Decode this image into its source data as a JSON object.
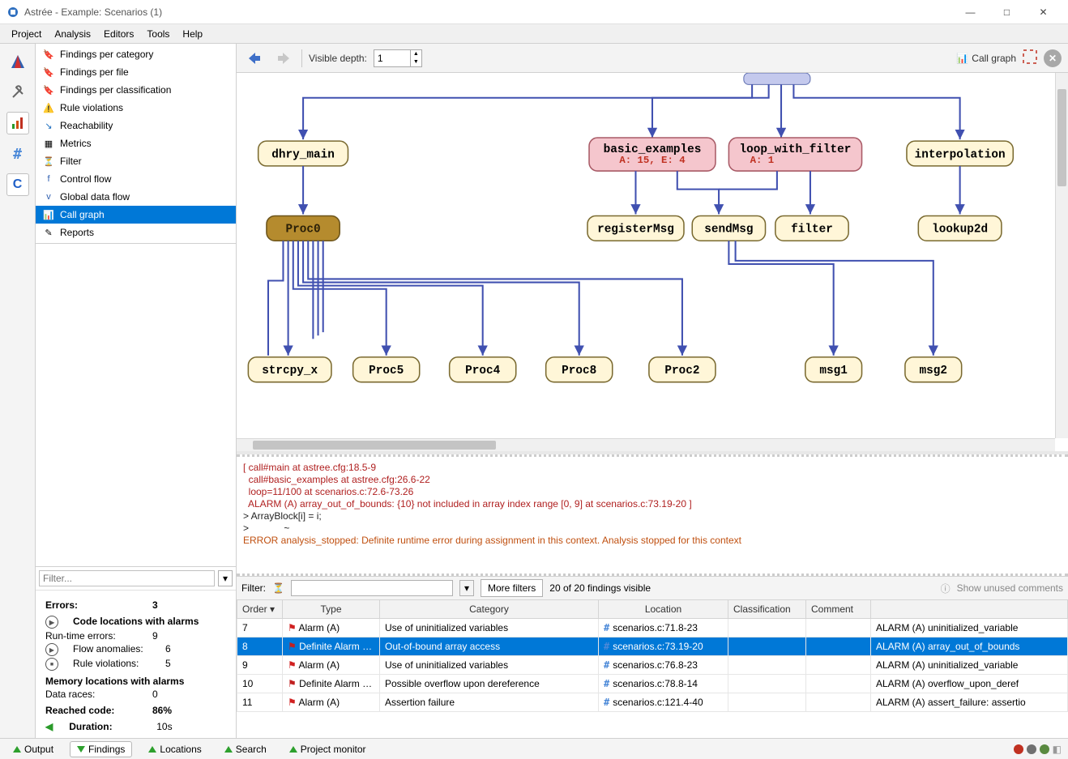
{
  "window": {
    "title": "Astrée - Example: Scenarios (1)"
  },
  "menu": {
    "items": [
      "Project",
      "Analysis",
      "Editors",
      "Tools",
      "Help"
    ]
  },
  "nav": {
    "items": [
      {
        "label": "Findings per category"
      },
      {
        "label": "Findings per file"
      },
      {
        "label": "Findings per classification"
      },
      {
        "label": "Rule violations"
      },
      {
        "label": "Reachability"
      },
      {
        "label": "Metrics"
      },
      {
        "label": "Filter"
      },
      {
        "label": "Control flow"
      },
      {
        "label": "Global data flow"
      },
      {
        "label": "Call graph",
        "selected": true
      },
      {
        "label": "Reports"
      }
    ]
  },
  "filterSidebar": {
    "placeholder": "Filter..."
  },
  "stats": {
    "errors_label": "Errors:",
    "errors": "3",
    "codeloc_header": "Code locations with alarms",
    "rte_label": "Run-time errors:",
    "rte": "9",
    "flow_label": "Flow anomalies:",
    "flow": "6",
    "rule_label": "Rule violations:",
    "rule": "5",
    "memloc_header": "Memory locations with alarms",
    "races_label": "Data races:",
    "races": "0",
    "reached_label": "Reached code:",
    "reached": "86%",
    "duration_label": "Duration:",
    "duration": "10s"
  },
  "graphToolbar": {
    "depthLabel": "Visible depth:",
    "depthValue": "1",
    "callGraphLabel": "Call graph"
  },
  "graph": {
    "nodes": {
      "dhry_main": {
        "label": "dhry_main",
        "fill": "#fff6d8",
        "stroke": "#7a6a30"
      },
      "basic_examples": {
        "label": "basic_examples",
        "sub": "A: 15,  E: 4",
        "fill": "#f5c6cd",
        "stroke": "#a85a66"
      },
      "loop_with_filter": {
        "label": "loop_with_filter",
        "sub": "A: 1",
        "fill": "#f5c6cd",
        "stroke": "#a85a66"
      },
      "interpolation": {
        "label": "interpolation",
        "fill": "#fff6d8",
        "stroke": "#7a6a30"
      },
      "proc0": {
        "label": "Proc0",
        "fill": "#b58b2e",
        "stroke": "#6c541b",
        "dark": true
      },
      "registerMsg": {
        "label": "registerMsg",
        "fill": "#fff6d8",
        "stroke": "#7a6a30"
      },
      "sendMsg": {
        "label": "sendMsg",
        "fill": "#fff6d8",
        "stroke": "#7a6a30"
      },
      "filter": {
        "label": "filter",
        "fill": "#fff6d8",
        "stroke": "#7a6a30"
      },
      "lookup2d": {
        "label": "lookup2d",
        "fill": "#fff6d8",
        "stroke": "#7a6a30"
      },
      "strcpy_x": {
        "label": "strcpy_x",
        "fill": "#fff6d8",
        "stroke": "#7a6a30"
      },
      "proc5": {
        "label": "Proc5",
        "fill": "#fff6d8",
        "stroke": "#7a6a30"
      },
      "proc4": {
        "label": "Proc4",
        "fill": "#fff6d8",
        "stroke": "#7a6a30"
      },
      "proc8": {
        "label": "Proc8",
        "fill": "#fff6d8",
        "stroke": "#7a6a30"
      },
      "proc2": {
        "label": "Proc2",
        "fill": "#fff6d8",
        "stroke": "#7a6a30"
      },
      "msg1": {
        "label": "msg1",
        "fill": "#fff6d8",
        "stroke": "#7a6a30"
      },
      "msg2": {
        "label": "msg2",
        "fill": "#fff6d8",
        "stroke": "#7a6a30"
      }
    }
  },
  "log": {
    "l1": "[ call#main at astree.cfg:18.5-9",
    "l2": "  call#basic_examples at astree.cfg:26.6-22",
    "l3": "  loop=11/100 at scenarios.c:72.6-73.26",
    "l4": "  ALARM (A) array_out_of_bounds: {10} not included in array index range [0, 9] at scenarios.c:73.19-20 ]",
    "l5": "> ArrayBlock[i] = i;",
    "l6": ">             ~",
    "l7": "ERROR analysis_stopped: Definite runtime error during assignment in this context. Analysis stopped for this context"
  },
  "findings": {
    "filterLabel": "Filter:",
    "moreFilters": "More filters",
    "countText": "20 of 20 findings visible",
    "showUnused": "Show unused comments",
    "cols": [
      "Order",
      "Type",
      "Category",
      "Location",
      "Classification",
      "Comment",
      ""
    ],
    "rows": [
      {
        "order": "7",
        "type": "Alarm (A)",
        "def": false,
        "cat": "Use of uninitialized variables",
        "loc": "scenarios.c:71.8-23",
        "msg": "ALARM (A) uninitialized_variable"
      },
      {
        "order": "8",
        "type": "Definite Alarm (A)",
        "def": true,
        "cat": "Out-of-bound array access",
        "loc": "scenarios.c:73.19-20",
        "msg": "ALARM (A) array_out_of_bounds",
        "selected": true
      },
      {
        "order": "9",
        "type": "Alarm (A)",
        "def": false,
        "cat": "Use of uninitialized variables",
        "loc": "scenarios.c:76.8-23",
        "msg": "ALARM (A) uninitialized_variable"
      },
      {
        "order": "10",
        "type": "Definite Alarm (A)",
        "def": true,
        "cat": "Possible overflow upon dereference",
        "loc": "scenarios.c:78.8-14",
        "msg": "ALARM (A) overflow_upon_deref"
      },
      {
        "order": "11",
        "type": "Alarm (A)",
        "def": false,
        "cat": "Assertion failure",
        "loc": "scenarios.c:121.4-40",
        "msg": "ALARM (A) assert_failure: assertio"
      }
    ]
  },
  "bottomTabs": {
    "items": [
      {
        "label": "Output"
      },
      {
        "label": "Findings",
        "sel": true,
        "down": true
      },
      {
        "label": "Locations"
      },
      {
        "label": "Search"
      },
      {
        "label": "Project monitor"
      }
    ]
  }
}
